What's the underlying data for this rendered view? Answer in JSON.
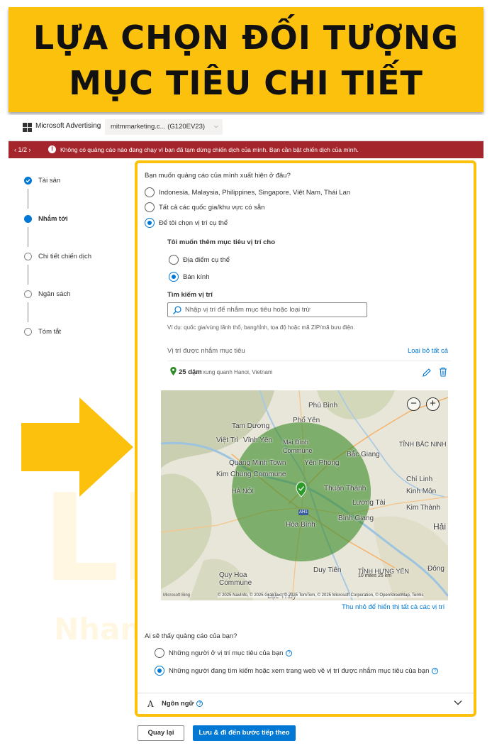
{
  "banner": {
    "line1": "LỰA CHỌN ĐỐI TƯỢNG",
    "line2": "MỤC TIÊU CHI TIẾT"
  },
  "header": {
    "brand": "Microsoft Advertising",
    "account": "mitmmarketing.c...  (G120EV23)"
  },
  "alert": {
    "pager": "1/2",
    "message": "Không có quảng cáo nào đang chạy vì bạn đã tạm dừng chiến dịch của mình. Bạn cần bật chiến dịch của mình."
  },
  "steps": [
    {
      "label": "Tài sản",
      "state": "done"
    },
    {
      "label": "Nhắm tới",
      "state": "current"
    },
    {
      "label": "Chi tiết chiến dịch",
      "state": "todo"
    },
    {
      "label": "Ngân sách",
      "state": "todo"
    },
    {
      "label": "Tóm tắt",
      "state": "todo"
    }
  ],
  "where": {
    "question": "Bạn muốn quảng cáo của mình xuất hiện ở đâu?",
    "options": [
      "Indonesia, Malaysia, Philippines, Singapore, Việt Nam, Thái Lan",
      "Tất cả các quốc gia/khu vực có sẵn",
      "Để tôi chọn vị trí cụ thể"
    ],
    "selected": 2
  },
  "add_target": {
    "title": "Tôi muốn thêm mục tiêu vị trí cho",
    "options": [
      "Địa điểm cụ thể",
      "Bán kính"
    ],
    "selected": 1
  },
  "search": {
    "title": "Tìm kiếm vị trí",
    "placeholder": "Nhập vị trí để nhắm mục tiêu hoặc loại trừ",
    "hint": "Ví dụ: quốc gia/vùng lãnh thổ, bang/tỉnh, tọa độ hoặc mã ZIP/mã bưu điện."
  },
  "targeted": {
    "header": "Vị trí được nhắm mục tiêu",
    "remove_all": "Loại bỏ tất cả",
    "radius": "25 dặm",
    "near": "xung quanh Hanoi, Vietnam"
  },
  "map": {
    "labels": {
      "phu_binh": "Phú Bình",
      "pho_yen": "Phổ Yên",
      "tam_duong": "Tam Dương",
      "viet_tri": "Việt Trì",
      "vinh_yen": "Vĩnh Yên",
      "mai_dinh": "Mai Đình",
      "commune1": "Commune",
      "bac_giang": "Bắc Giang",
      "tinh_bac_ninh": "TỈNH BẮC NINH",
      "quang_minh": "Quang Minh Town",
      "yen_phong": "Yên Phong",
      "kim_chung": "Kim Chung Commune",
      "chi_linh": "Chí Linh",
      "ha_noi": "HÀ NỘI",
      "thuan_thanh": "Thuận Thành",
      "kinh_mon": "Kinh Môn",
      "luong_tai": "Lương Tài",
      "kim_thanh": "Kim Thành",
      "hoa_binh": "Hòa Bình",
      "binh_giang": "Bình Giang",
      "hai": "Hải",
      "quy_hoa": "Quy Hoa",
      "commune2": "Commune",
      "duy_tien": "Duy Tiên",
      "tinh_hung_yen": "TỈNH HƯNG YÊN",
      "dong": "Đông",
      "lac_thuy": "Lạc Thủy",
      "ah1": "AH1"
    },
    "zoom_out": "−",
    "zoom_in": "+",
    "scale": "10 miles   25 km",
    "bing": "Microsoft Bing",
    "attribution": "© 2025 NavInfo, © 2025 GrabTaxi, © 2025 TomTom, © 2025 Microsoft Corporation, © OpenStreetMap, Terms"
  },
  "collapse_link": "Thu nhỏ để hiển thị tất cả các vị trí",
  "who": {
    "question": "Ai sẽ thấy quảng cáo của bạn?",
    "options": [
      "Những người ở vị trí mục tiêu của bạn",
      "Những người đang tìm kiếm hoặc xem trang web về vị trí được nhắm mục tiêu của bạn"
    ],
    "selected": 1
  },
  "language": {
    "label": "Ngôn ngữ"
  },
  "buttons": {
    "back": "Quay lại",
    "next": "Lưu & đi đến bước tiếp theo"
  },
  "watermark": {
    "letters": "LI",
    "tagline": "Nhanh - Chuẩn - Đẹp"
  },
  "colors": {
    "banner": "#fcc10d",
    "accent": "#0078d4",
    "alert": "#a4262c",
    "map_circle": "#3c8a2a"
  }
}
